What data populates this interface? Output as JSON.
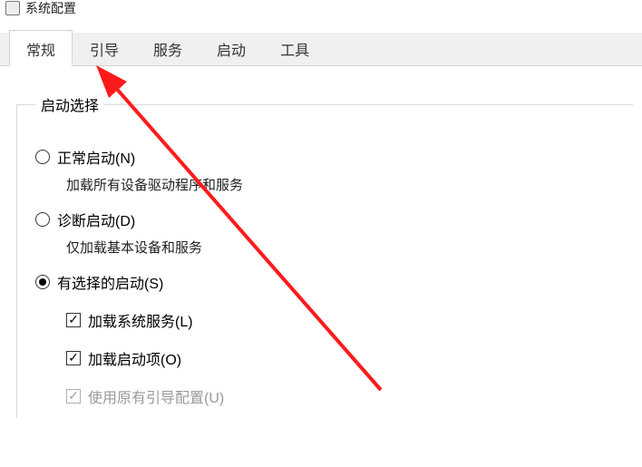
{
  "window": {
    "title": "系统配置"
  },
  "tabs": [
    {
      "label": "常规"
    },
    {
      "label": "引导"
    },
    {
      "label": "服务"
    },
    {
      "label": "启动"
    },
    {
      "label": "工具"
    }
  ],
  "group": {
    "title": "启动选择",
    "options": [
      {
        "label": "正常启动(N)",
        "desc": "加载所有设备驱动程序和服务"
      },
      {
        "label": "诊断启动(D)",
        "desc": "仅加载基本设备和服务"
      },
      {
        "label": "有选择的启动(S)"
      }
    ],
    "subchecks": [
      {
        "label": "加载系统服务(L)"
      },
      {
        "label": "加载启动项(O)"
      },
      {
        "label": "使用原有引导配置(U)"
      }
    ]
  },
  "annotation": {
    "color": "#ff1a1a"
  }
}
